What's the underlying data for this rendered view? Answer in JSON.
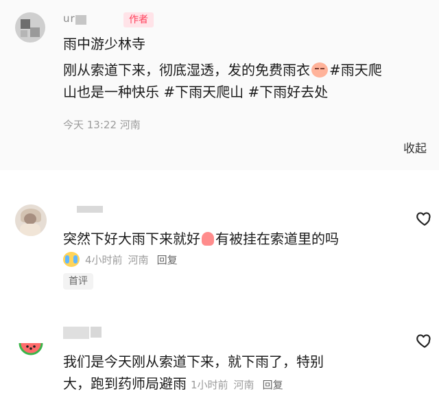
{
  "post": {
    "author": {
      "name_visible": "ur",
      "badge": "作者"
    },
    "lines": [
      "雨中游少林寺",
      "刚从索道下来，彻底湿透，发的免费雨衣",
      "#雨天爬",
      "山也是一种快乐 #下雨天爬山 #下雨好去处"
    ],
    "meta": "今天 13:22 河南",
    "collapse_label": "收起"
  },
  "comments": [
    {
      "text_before_emoji": "突然下好大雨下来就好",
      "text_after_emoji": "有被挂在索道里的吗",
      "time": "4小时前",
      "place": "河南",
      "reply_label": "回复",
      "badge": "首评",
      "icons": {
        "like": "heart-icon",
        "reaction": "crying-face-icon",
        "inline": "thumb-icon"
      }
    },
    {
      "lines": [
        "我们是今天刚从索道下来，就下雨了，特别",
        "大，跑到药师局避雨"
      ],
      "time": "1小时前",
      "place": "河南",
      "reply_label": "回复",
      "icons": {
        "avatar": "watermelon-icon",
        "like": "heart-icon"
      }
    }
  ],
  "colors": {
    "accent": "#ff3f5a",
    "badge_bg": "#ffe3e8",
    "meta": "#9b9b9b"
  }
}
